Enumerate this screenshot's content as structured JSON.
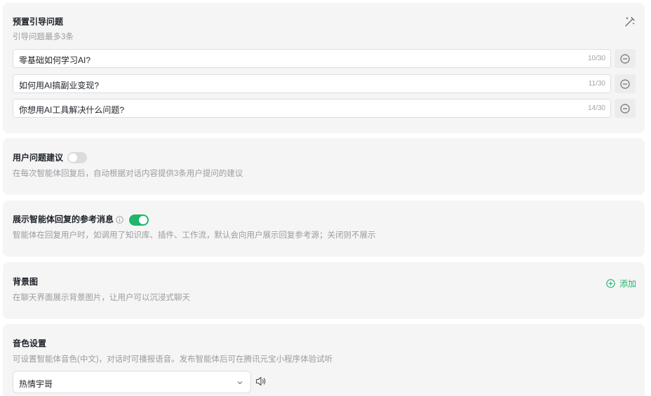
{
  "preset_questions": {
    "title": "预置引导问题",
    "subtitle": "引导问题最多3条",
    "wand_icon": "magic-wand-icon",
    "items": [
      {
        "text": "零基础如何学习AI?",
        "count": "10/30"
      },
      {
        "text": "如何用AI搞副业变现?",
        "count": "11/30"
      },
      {
        "text": "你想用AI工具解决什么问题?",
        "count": "14/30"
      }
    ]
  },
  "user_suggestions": {
    "title": "用户问题建议",
    "desc": "在每次智能体回复后，自动根据对话内容提供3条用户提问的建议",
    "enabled": false
  },
  "show_references": {
    "title": "展示智能体回复的参考消息",
    "desc": "智能体在回复用户时，如调用了知识库、插件、工作流，默认会向用户展示回复参考源；关闭则不展示",
    "enabled": true
  },
  "background": {
    "title": "背景图",
    "desc": "在聊天界面展示背景图片，让用户可以沉浸式聊天",
    "add_label": "添加"
  },
  "voice": {
    "title": "音色设置",
    "desc": "可设置智能体音色(中文)，对话时可播报语音。发布智能体后可在腾讯元宝小程序体验试听",
    "selected": "热情宇哥"
  },
  "colors": {
    "accent": "#20b66a",
    "card_bg": "#f5f5f5"
  }
}
